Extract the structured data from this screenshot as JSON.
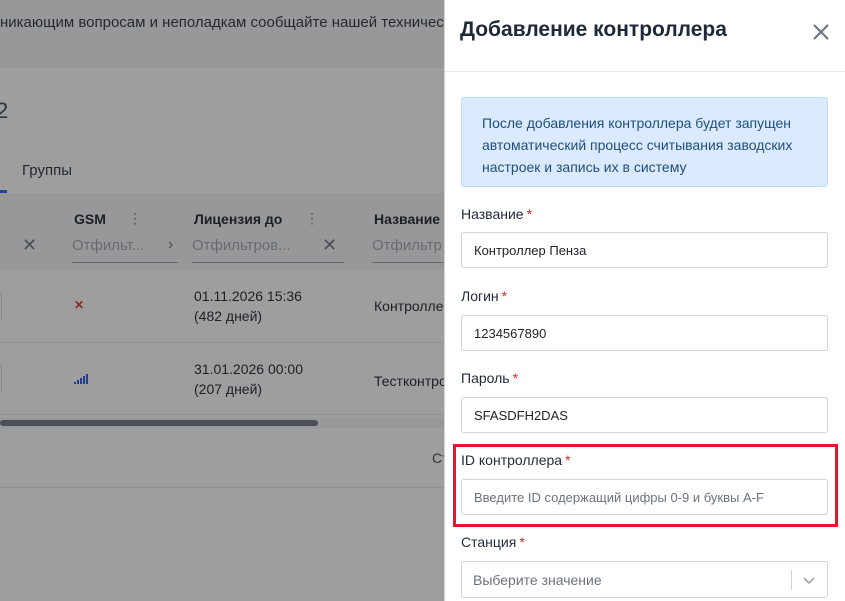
{
  "background": {
    "notice_text": "никающим вопросам и неполадкам сообщайте нашей техническо",
    "page_heading": "2",
    "tabs": [
      {
        "label": "Группы"
      }
    ],
    "table": {
      "columns": [
        {
          "title": "GSM",
          "filter_placeholder": "Отфильт..."
        },
        {
          "title": "Лицензия до",
          "filter_placeholder": "Отфильтров..."
        },
        {
          "title": "Название",
          "filter_placeholder": "Отфильтр"
        }
      ],
      "rows": [
        {
          "gsm_status": "error",
          "license_date": "01.11.2026 15:36",
          "license_days": "(482 дней)",
          "name": "Контроллер"
        },
        {
          "gsm_status": "signal",
          "license_date": "31.01.2026 00:00",
          "license_days": "(207 дней)",
          "name": "Тестконтро"
        }
      ]
    },
    "pager_text": "Ст"
  },
  "drawer": {
    "title": "Добавление контроллера",
    "info_text": "После добавления контроллера будет запущен автоматический процесс считывания заводских настроек и запись их в систему",
    "required_mark": "*",
    "fields": {
      "name": {
        "label": "Название",
        "value": "Контроллер Пенза"
      },
      "login": {
        "label": "Логин",
        "value": "1234567890"
      },
      "password": {
        "label": "Пароль",
        "value": "SFASDFH2DAS"
      },
      "controller_id": {
        "label": "ID контроллера",
        "placeholder": "Введите ID содержащий цифры 0-9 и буквы A-F"
      },
      "station": {
        "label": "Станция",
        "placeholder": "Выберите значение"
      }
    }
  },
  "colors": {
    "accent": "#2563eb",
    "required": "#dc2626",
    "highlight": "#dc1c2d",
    "info_bg": "#dbeafe",
    "info_text": "#1e4f7a"
  }
}
